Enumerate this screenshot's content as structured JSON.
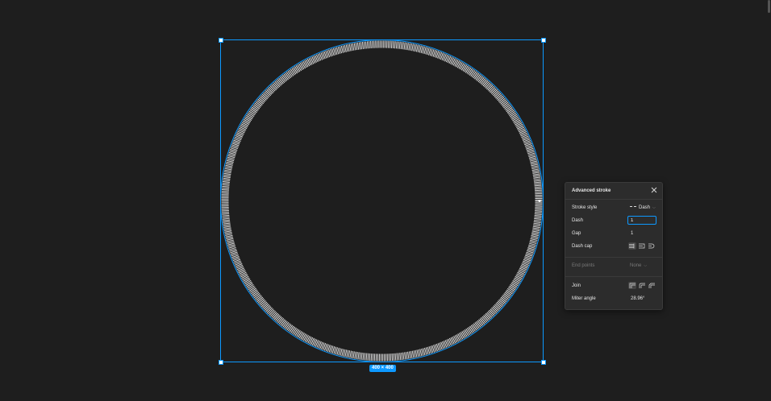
{
  "canvas": {
    "background": "#1e1e1e",
    "selection_color": "#0d99ff",
    "size_label": "400 × 400"
  },
  "panel": {
    "title": "Advanced stroke",
    "close_icon": "close-icon",
    "stroke_style": {
      "label": "Stroke style",
      "value": "Dash",
      "icon": "dashed-line-icon"
    },
    "dash": {
      "label": "Dash",
      "value": "1"
    },
    "gap": {
      "label": "Gap",
      "value": "1"
    },
    "dash_cap": {
      "label": "Dash cap",
      "options": [
        "cap-none-icon",
        "cap-square-icon",
        "cap-round-icon"
      ],
      "selected": 0
    },
    "end_points": {
      "label": "End points",
      "value": "None"
    },
    "join": {
      "label": "Join",
      "options": [
        "join-miter-icon",
        "join-round-icon",
        "join-bevel-icon"
      ],
      "selected": 0
    },
    "miter_angle": {
      "label": "Miter angle",
      "value": "28.96°"
    }
  }
}
